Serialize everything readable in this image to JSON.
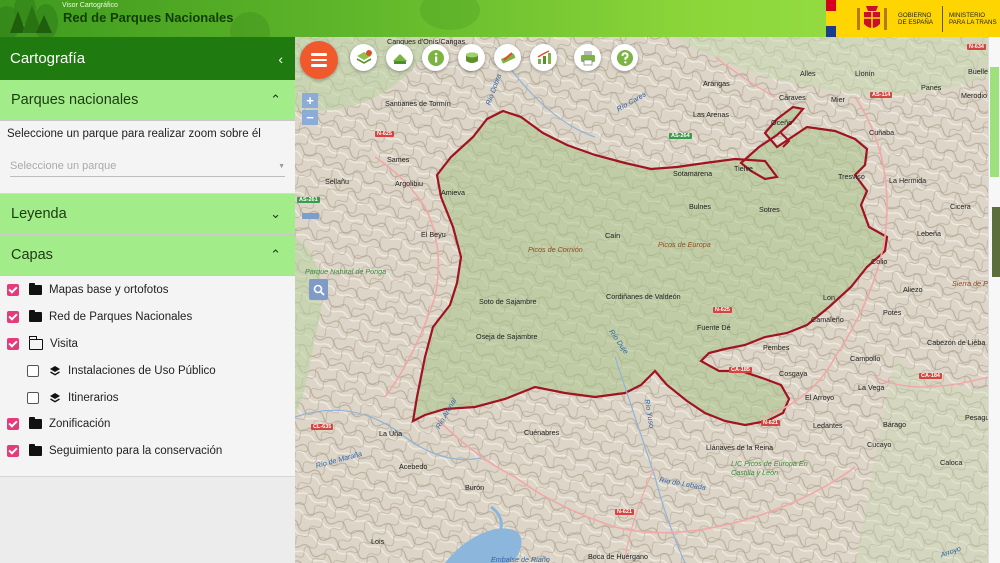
{
  "header": {
    "app_subtitle": "Visor Cartográfico",
    "app_title": "Red de Parques Nacionales",
    "government_label": [
      "GOBIERNO",
      "DE ESPAÑA"
    ],
    "ministry_label": [
      "MINISTERIO",
      "PARA LA TRANS"
    ]
  },
  "sidebar": {
    "title": "Cartografía",
    "collapse_icon": "chevron-left-icon",
    "parques": {
      "label": "Parques nacionales",
      "hint": "Seleccione un parque para realizar zoom sobre él",
      "select_placeholder": "Seleccione un parque"
    },
    "leyenda": {
      "label": "Leyenda"
    },
    "capas": {
      "label": "Capas",
      "layers": [
        {
          "label": "Mapas base y ortofotos",
          "checked": true,
          "icon": "folder-icon"
        },
        {
          "label": "Red de Parques Nacionales",
          "checked": true,
          "icon": "folder-icon"
        },
        {
          "label": "Visita",
          "checked": true,
          "icon": "folder-open-icon"
        },
        {
          "label": "Instalaciones de Uso Público",
          "checked": false,
          "icon": "layers-icon"
        },
        {
          "label": "Itinerarios",
          "checked": false,
          "icon": "layers-icon"
        },
        {
          "label": "Zonificación",
          "checked": true,
          "icon": "folder-icon"
        },
        {
          "label": "Seguimiento para la conservación",
          "checked": true,
          "icon": "folder-icon"
        }
      ]
    }
  },
  "map": {
    "zoom_in": "+",
    "zoom_out": "−",
    "toolbar_icons": [
      "layers-add-icon",
      "basemap-icon",
      "info-icon",
      "layer-stack-icon",
      "measure-icon",
      "chart-icon",
      "print-icon",
      "help-icon"
    ],
    "place_labels": {
      "cangas": "Cangues d'Onís/Cangas",
      "santianes": "Santianes de Tormín",
      "ariongas": "Arangas",
      "alles": "Alles",
      "llonin": "Llonín",
      "panes": "Panes",
      "buelles": "Buelle",
      "carraves": "Cáraves",
      "mier": "Mier",
      "merodio": "Merodio",
      "lasarenas": "Las Arenas",
      "ocenio": "Oceño",
      "cunaba": "Cuñaba",
      "sames": "Sames",
      "tielve": "Tielve",
      "sotres": "Sotres",
      "tresviso": "Tresviso",
      "lahermida": "La Hermida",
      "sellanu": "Sellañu",
      "argolibiu": "Argolibiu",
      "amieva": "Amieva",
      "sotamarena": "Sotamarena",
      "bulnes": "Bulnes",
      "cicera": "Cicera",
      "lebena": "Lebeña",
      "elbeyu": "El Beyu",
      "cain": "Caín",
      "colio": "Colio",
      "aliezo": "Aliezo",
      "soto": "Soto de Sajambre",
      "cordinanes": "Cordiñanes de Valdeón",
      "lon": "Lon",
      "camaleno": "Camaleño",
      "potes": "Potes",
      "oseja": "Oseja de Sajambre",
      "fuentede": "Fuente Dé",
      "pembes": "Pembes",
      "campollo": "Campollo",
      "cabezon": "Cabezón de Liéba",
      "cosgaya": "Cosgaya",
      "lavega": "La Vega",
      "elarroyo": "El Arroyo",
      "launa": "La Uña",
      "cuenabres": "Cuénabres",
      "ledantes": "Ledantes",
      "barago": "Bárago",
      "pesaguero": "Pesague",
      "llanaves": "Llánaves de la Reina",
      "cucayo": "Cucayo",
      "caloca": "Caloca",
      "acebedo": "Acebedo",
      "buron": "Burón",
      "lois": "Lois",
      "boca": "Boca de Huérgano",
      "picos_cornion": "Picos de Cornión",
      "picos_europa": "Picos de Europa",
      "ponga": "Parque Natural de Ponga",
      "lic": "LIC Picos de Europa En Castilla y León",
      "sierra": "Sierra de P",
      "rio_cares": "Río Cares",
      "rio_duje": "Río Duje",
      "rio_dobra": "Río Dobra",
      "rio_arenal": "Río Arenal",
      "rio_maraña": "Río de Maraña",
      "rio_yuso": "Río Yuso",
      "rio_lebada": "Río de Lebada",
      "embalse": "Embalse de Riaño",
      "arroyo": "Arroyo"
    },
    "road_labels": {
      "n625a": "N-625",
      "n625b": "N-625",
      "as264": "AS-264",
      "as114": "AS-114",
      "as261": "AS-261",
      "cl635": "CL-635",
      "n621a": "N-621",
      "n621b": "N-621",
      "ca184": "CA-184",
      "ca185": "CA-185",
      "n634": "N-634"
    }
  }
}
